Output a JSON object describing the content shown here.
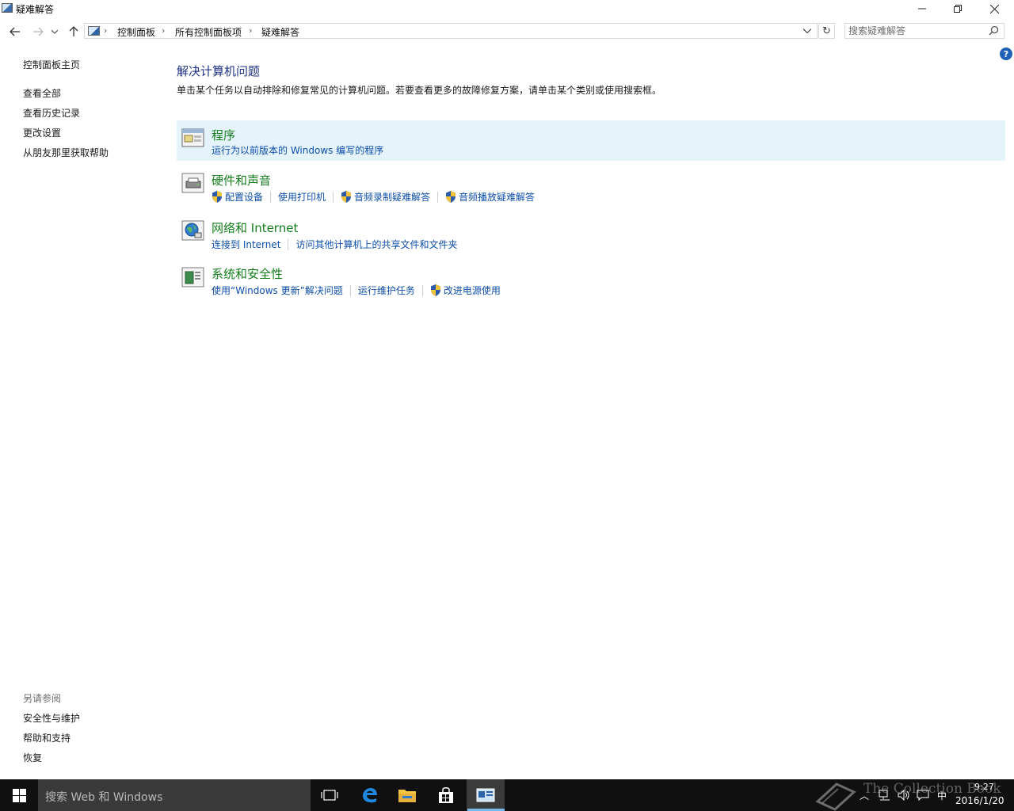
{
  "window": {
    "title": "疑难解答"
  },
  "addressbar": {
    "breadcrumbs": [
      "控制面板",
      "所有控制面板项",
      "疑难解答"
    ]
  },
  "search": {
    "placeholder": "搜索疑难解答"
  },
  "sidebar": {
    "home": "控制面板主页",
    "items": [
      {
        "label": "查看全部"
      },
      {
        "label": "查看历史记录"
      },
      {
        "label": "更改设置"
      },
      {
        "label": "从朋友那里获取帮助"
      }
    ],
    "see_also_heading": "另请参阅",
    "see_also": [
      {
        "label": "安全性与维护"
      },
      {
        "label": "帮助和支持"
      },
      {
        "label": "恢复"
      }
    ]
  },
  "main": {
    "title": "解决计算机问题",
    "description": "单击某个任务以自动排除和修复常见的计算机问题。若要查看更多的故障修复方案，请单击某个类别或使用搜索框。",
    "categories": [
      {
        "title": "程序",
        "links": [
          {
            "label": "运行为以前版本的 Windows 编写的程序"
          }
        ]
      },
      {
        "title": "硬件和声音",
        "links": [
          {
            "label": "配置设备"
          },
          {
            "label": "使用打印机"
          },
          {
            "label": "音频录制疑难解答"
          },
          {
            "label": "音频播放疑难解答"
          }
        ]
      },
      {
        "title": "网络和 Internet",
        "links": [
          {
            "label": "连接到 Internet"
          },
          {
            "label": "访问其他计算机上的共享文件和文件夹"
          }
        ]
      },
      {
        "title": "系统和安全性",
        "links": [
          {
            "label": "使用“Windows 更新”解决问题"
          },
          {
            "label": "运行维护任务"
          },
          {
            "label": "改进电源使用"
          }
        ]
      }
    ]
  },
  "taskbar": {
    "search_text": "搜索 Web 和 Windows",
    "time": "9:27",
    "date": "2016/1/20",
    "ime": "中",
    "watermark": "The Collection Book"
  },
  "colors": {
    "title_blue": "#1e3287",
    "category_green": "#147d1c",
    "link_blue": "#0d4eaa",
    "hover_bg": "#e5f3fb",
    "taskbar": "#101010"
  }
}
